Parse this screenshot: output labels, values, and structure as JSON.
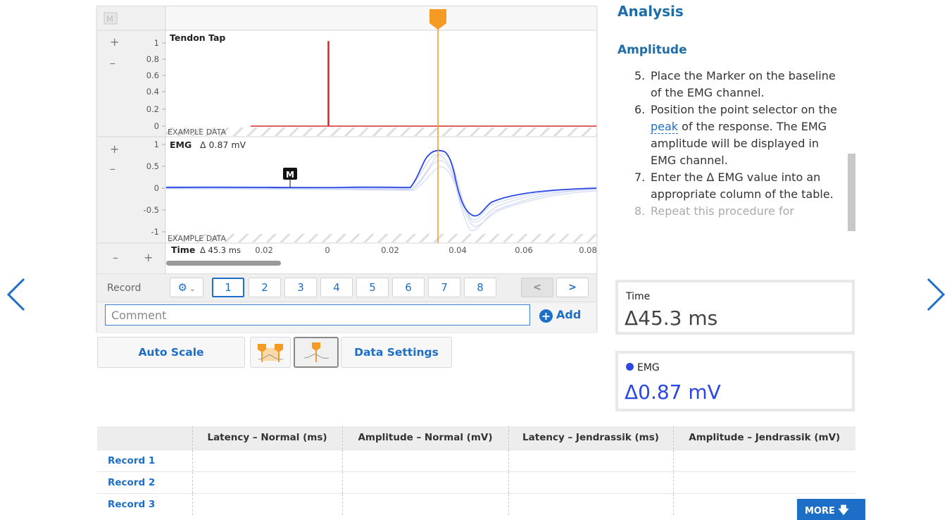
{
  "chart": {
    "marker_box_label": "M",
    "tendon": {
      "title": "Tendon Tap",
      "ticks": [
        "1",
        "0.8",
        "0.6",
        "0.4",
        "0.2",
        "0"
      ],
      "example_label": "EXAMPLE DATA"
    },
    "emg": {
      "title": "EMG",
      "delta": "Δ 0.87 mV",
      "ticks": [
        "1",
        "0.5",
        "0",
        "-0.5",
        "-1"
      ],
      "example_label": "EXAMPLE DATA",
      "marker_label": "M"
    },
    "time_axis": {
      "title": "Time",
      "delta": "Δ 45.3 ms",
      "ticks": [
        "0.02",
        "0",
        "0.02",
        "0.04",
        "0.06",
        "0.08"
      ]
    },
    "plus_label": "+",
    "minus_label": "–"
  },
  "records": {
    "label": "Record",
    "buttons": [
      "1",
      "2",
      "3",
      "4",
      "5",
      "6",
      "7",
      "8"
    ],
    "active": "1",
    "prev": "<",
    "next": ">"
  },
  "comment": {
    "placeholder": "Comment",
    "add_label": "Add"
  },
  "toolbar": {
    "auto_scale": "Auto Scale",
    "data_settings": "Data Settings"
  },
  "analysis": {
    "heading": "Analysis",
    "subheading": "Amplitude",
    "steps": [
      {
        "num": "5.",
        "text": "Place the Marker on the baseline of the EMG channel."
      },
      {
        "num": "6.",
        "before": "Position the point selector on the ",
        "link": "peak",
        "after": " of the response. The EMG amplitude will be displayed in EMG channel."
      },
      {
        "num": "7.",
        "text": "Enter the Δ EMG value into an appropriate column of the table."
      },
      {
        "num": "8.",
        "text": "Repeat this procedure for"
      }
    ]
  },
  "readouts": {
    "time_label": "Time",
    "time_value": "Δ45.3 ms",
    "emg_label": "EMG",
    "emg_value": "Δ0.87 mV",
    "emg_color": "#2a47e3"
  },
  "table": {
    "headers": [
      "",
      "Latency – Normal (ms)",
      "Amplitude – Normal (mV)",
      "Latency – Jendrassik (ms)",
      "Amplitude – Jendrassik (mV)"
    ],
    "rows": [
      "Record 1",
      "Record 2",
      "Record 3"
    ]
  },
  "more_label": "MORE",
  "colors": {
    "accent": "#1d6ec7",
    "heading": "#1e6ca8",
    "tendon_trace": "#d62b2b",
    "emg_trace": "#2a47e3",
    "cursor": "#f59a22"
  }
}
